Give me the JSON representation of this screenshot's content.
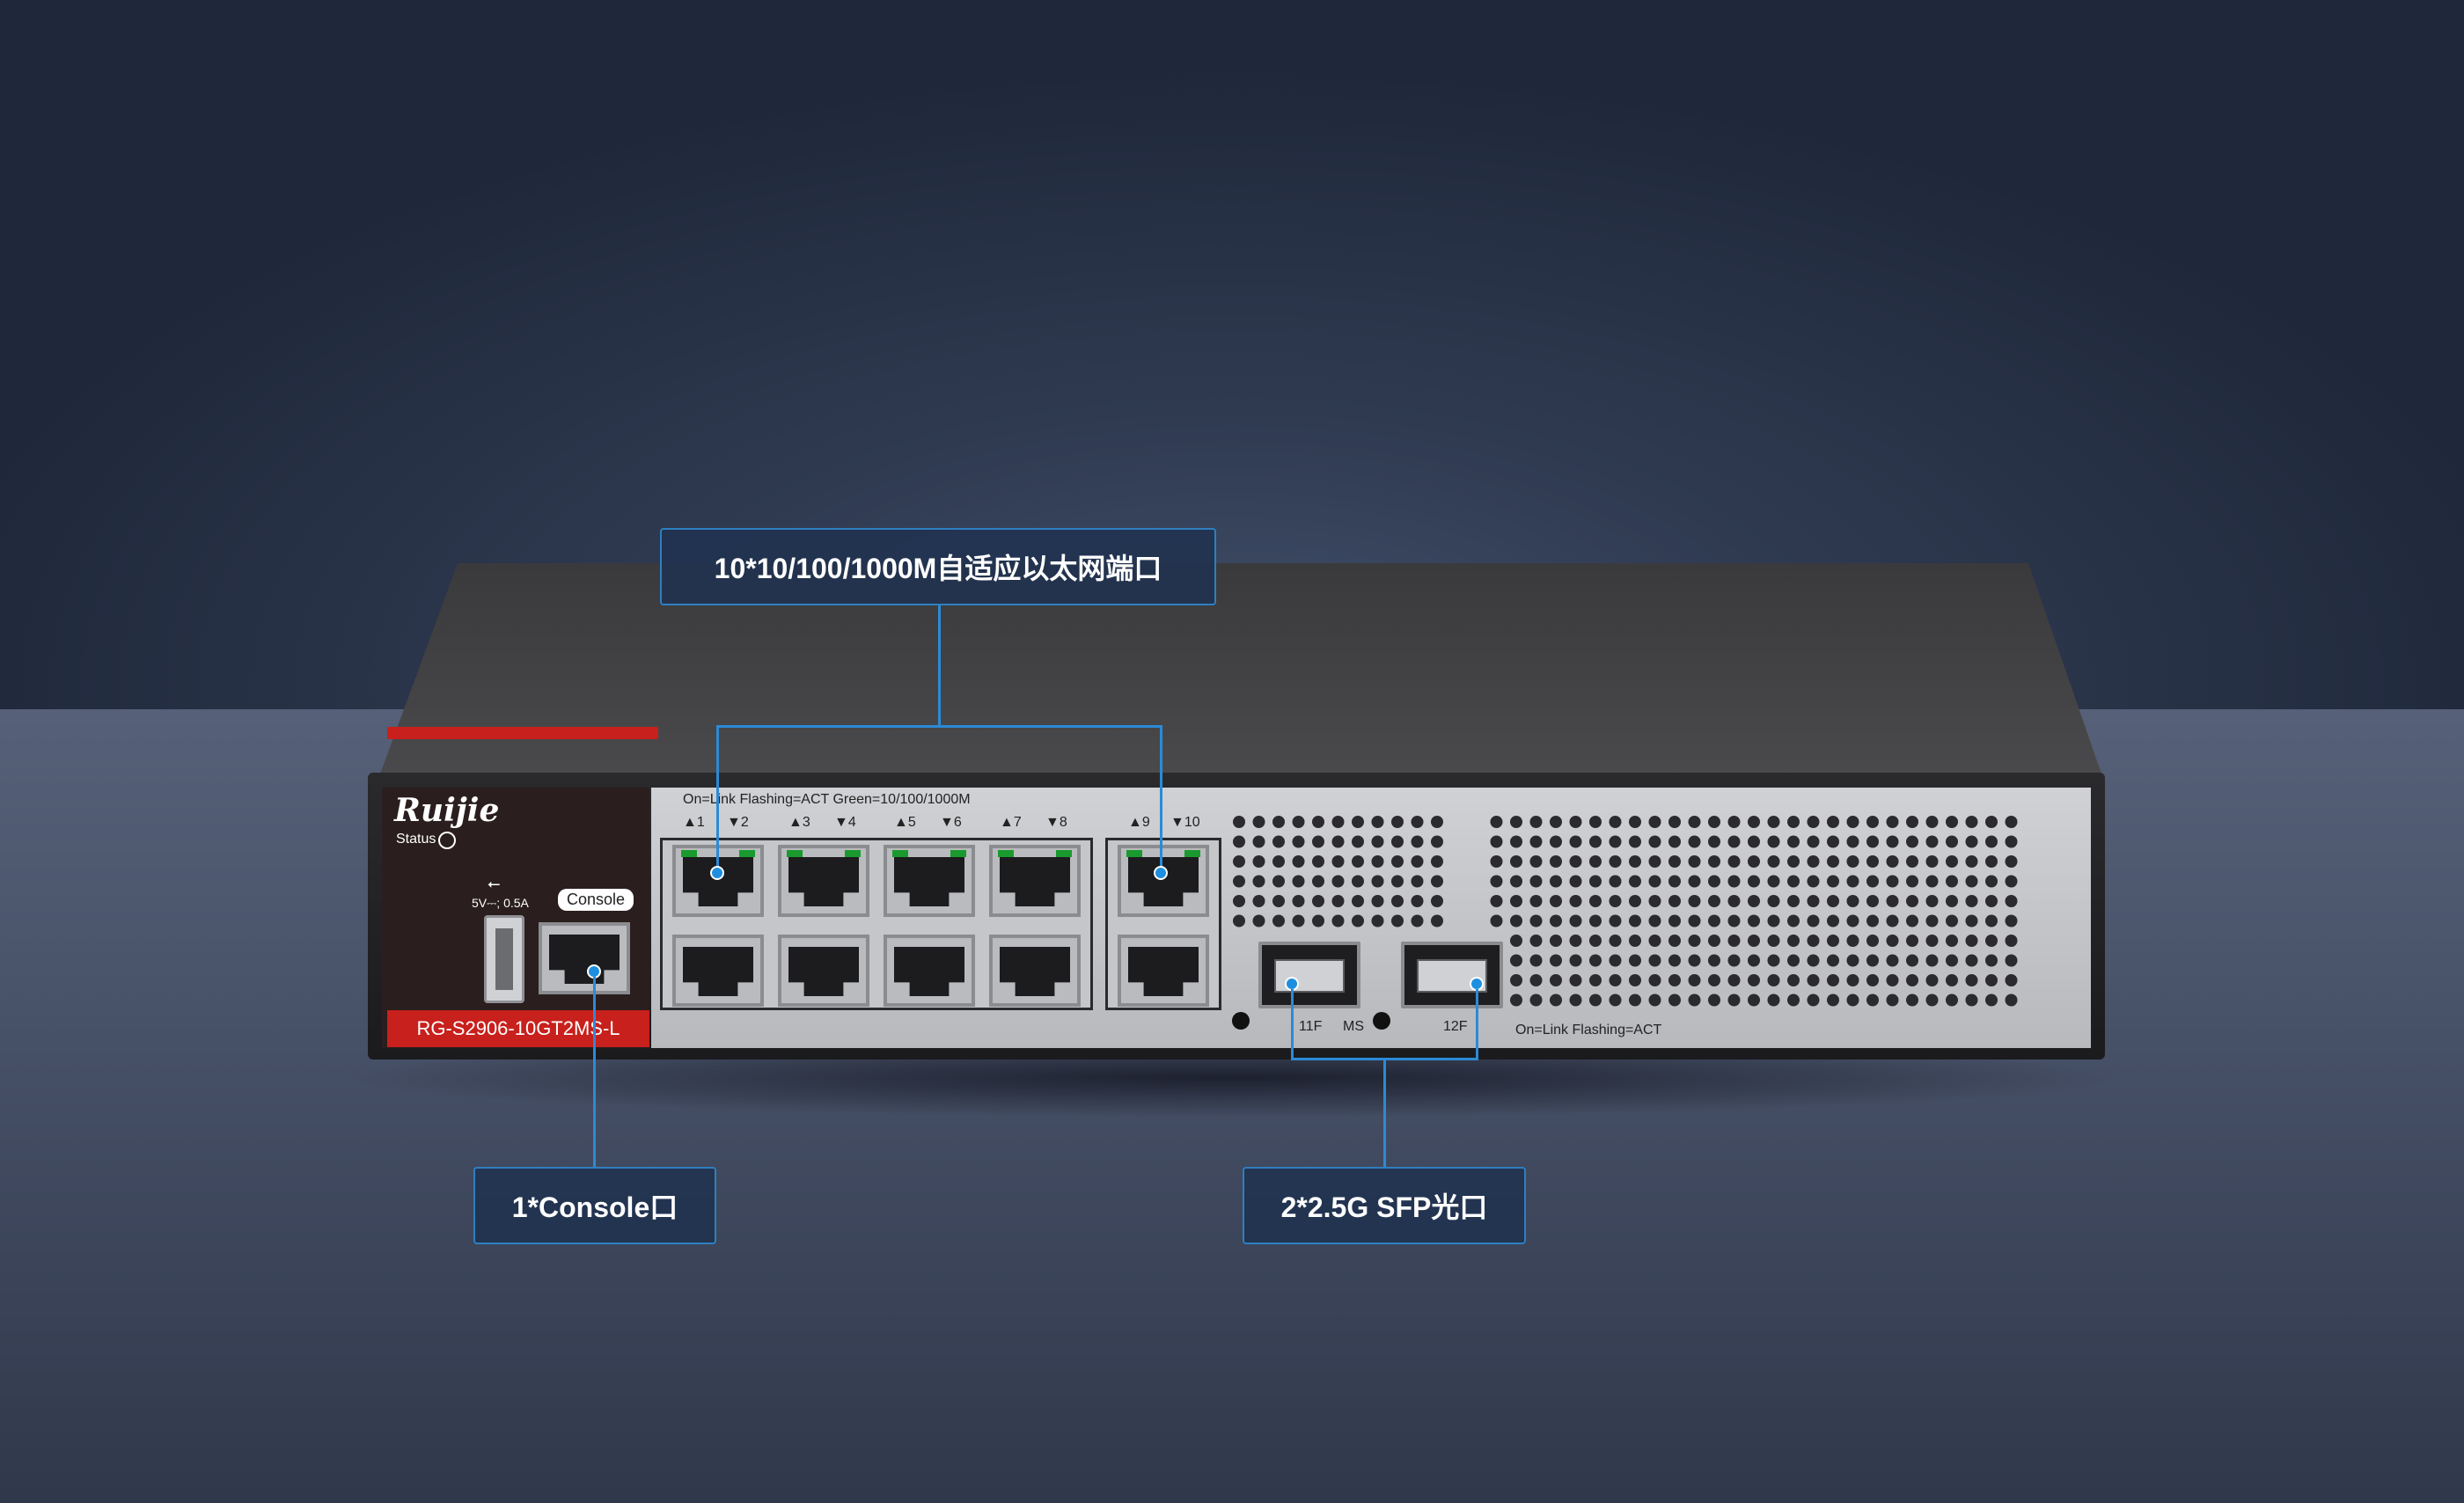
{
  "callouts": {
    "ethernet": "10*10/100/1000M自适应以太网端口",
    "console": "1*Console口",
    "sfp": "2*2.5G SFP光口"
  },
  "device": {
    "brand": "Ruijie",
    "status_label": "Status",
    "usb_symbol": "⭠",
    "usb_rating": "5V⎓; 0.5A",
    "console_label": "Console",
    "model": "RG-S2906-10GT2MS-L",
    "port_legend": "On=Link  Flashing=ACT  Green=10/100/1000M",
    "port_numbers": [
      "▲1",
      "▼2",
      "▲3",
      "▼4",
      "▲5",
      "▼6",
      "▲7",
      "▼8",
      "▲9",
      "▼10"
    ],
    "sfp_labels": [
      "11F",
      "MS",
      "12F"
    ],
    "sfp_legend": "On=Link  Flashing=ACT"
  },
  "colors": {
    "callout_border": "#2f7fc0",
    "callout_fill": "#203250",
    "lead_line": "#2c8ad6",
    "brand_red": "#c8201c",
    "link_led": "#1a9a2e"
  }
}
